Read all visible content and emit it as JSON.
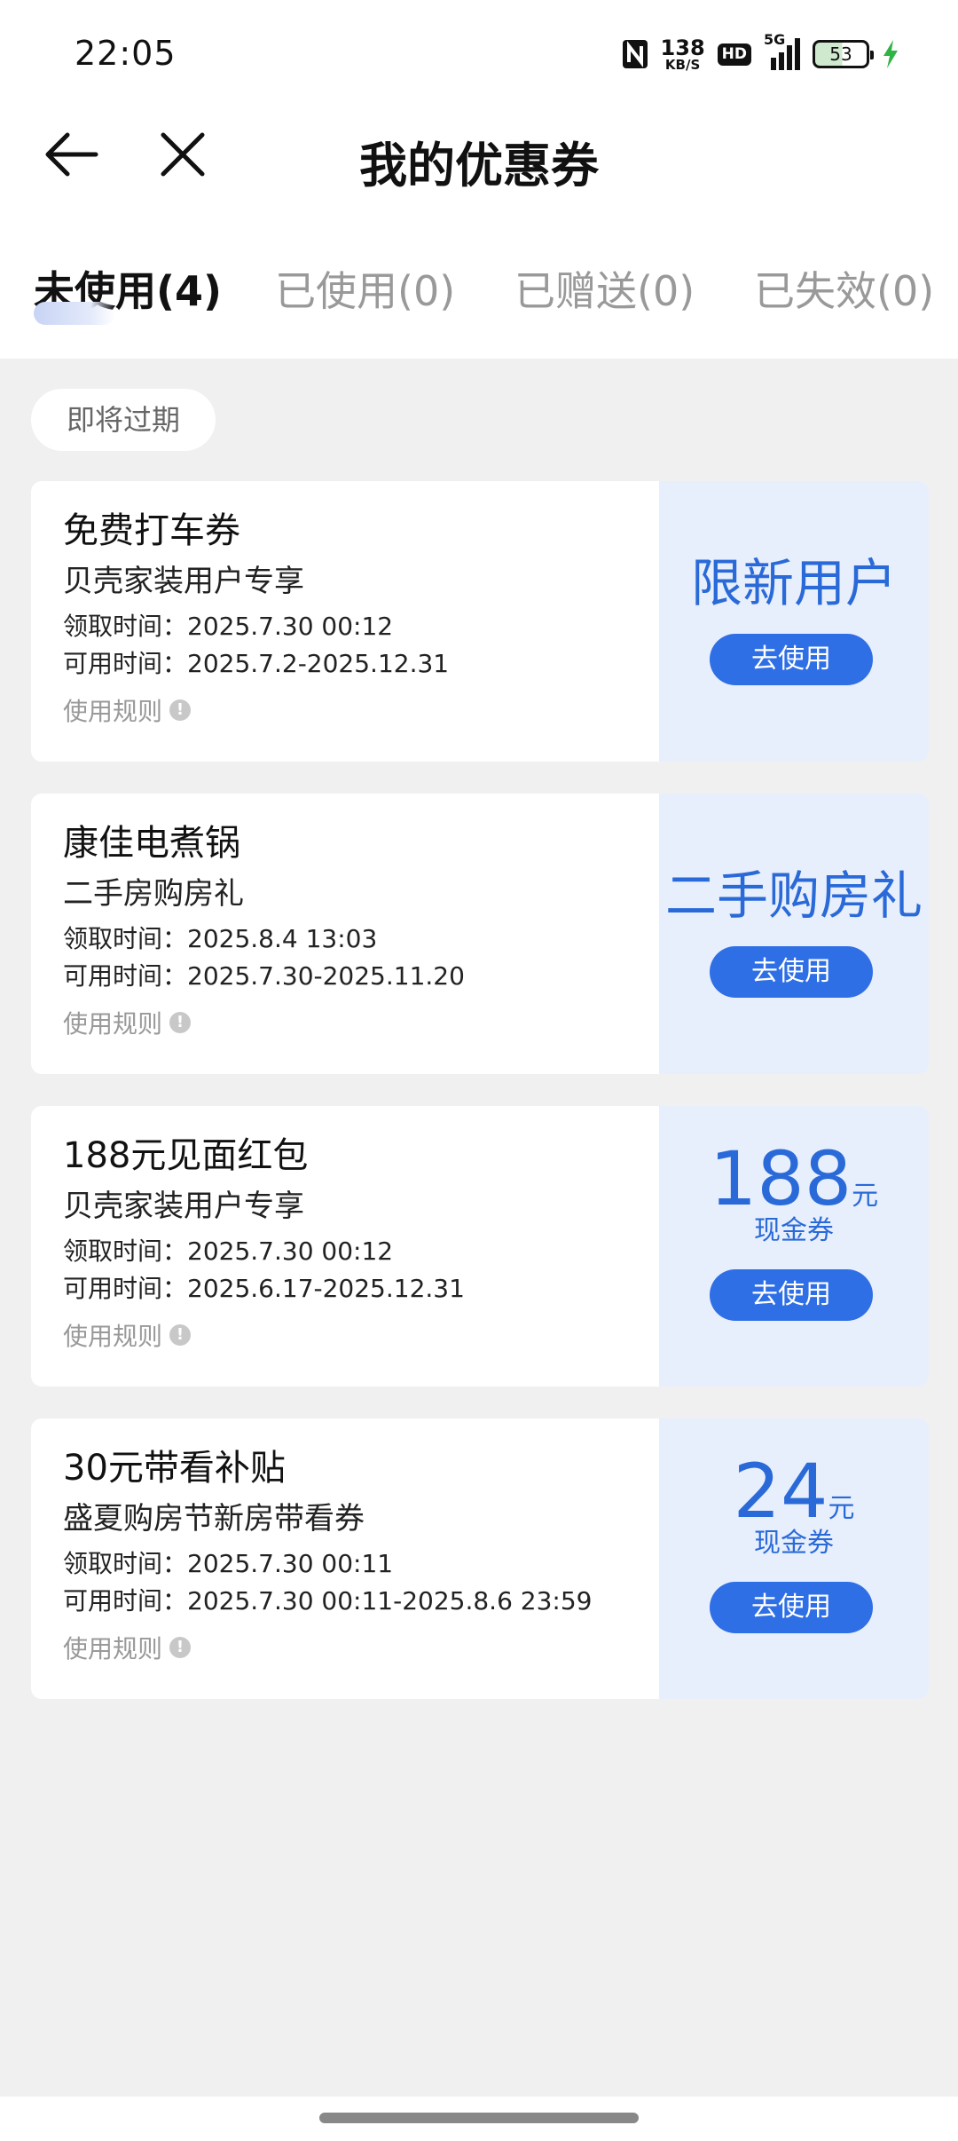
{
  "status_bar": {
    "time": "22:05",
    "net_speed_value": "138",
    "net_speed_unit": "KB/S",
    "hd": "HD",
    "network": "5G",
    "battery": "53",
    "icons": [
      "nfc-icon",
      "signal-icon",
      "battery-icon",
      "charging-bolt-icon"
    ]
  },
  "header": {
    "title": "我的优惠券",
    "back_icon": "arrow-left-icon",
    "close_icon": "close-icon"
  },
  "tabs": [
    {
      "label": "未使用(4)",
      "active": true
    },
    {
      "label": "已使用(0)",
      "active": false
    },
    {
      "label": "已赠送(0)",
      "active": false
    },
    {
      "label": "已失效(0)",
      "active": false
    }
  ],
  "section_chip": "即将过期",
  "coupons": [
    {
      "title": "免费打车券",
      "subtitle": "贝壳家装用户专享",
      "received": "领取时间：2025.7.30 00:12",
      "valid": "可用时间：2025.7.2-2025.12.31",
      "rules": "使用规则",
      "label": "限新用户",
      "button": "去使用"
    },
    {
      "title": "康佳电煮锅",
      "subtitle": "二手房购房礼",
      "received": "领取时间：2025.8.4 13:03",
      "valid": "可用时间：2025.7.30-2025.11.20",
      "rules": "使用规则",
      "label": "二手购房礼",
      "button": "去使用"
    },
    {
      "title": "188元见面红包",
      "subtitle": "贝壳家装用户专享",
      "received": "领取时间：2025.7.30 00:12",
      "valid": "可用时间：2025.6.17-2025.12.31",
      "rules": "使用规则",
      "amount": "188",
      "unit": "元",
      "type": "现金券",
      "button": "去使用"
    },
    {
      "title": "30元带看补贴",
      "subtitle": "盛夏购房节新房带看券",
      "received": "领取时间：2025.7.30 00:11",
      "valid": "可用时间：2025.7.30 00:11-2025.8.6 23:59",
      "rules": "使用规则",
      "amount": "24",
      "unit": "元",
      "type": "现金券",
      "button": "去使用"
    }
  ],
  "colors": {
    "accent": "#2f6fe6",
    "accent_text": "#2a6ad8",
    "coupon_right_bg": "#e8effc",
    "page_bg": "#f0f0f0"
  }
}
